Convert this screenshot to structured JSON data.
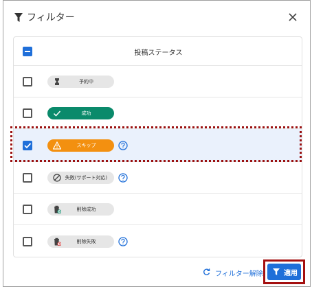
{
  "dialog": {
    "title": "フィルター",
    "title_icon": "filter-icon",
    "close_icon": "close-icon"
  },
  "table": {
    "header": "投稿ステータス",
    "select_all_state": "indeterminate",
    "rows": [
      {
        "label": "予約中",
        "icon": "hourglass-icon",
        "checked": false,
        "help": false
      },
      {
        "label": "成功",
        "icon": "check-icon",
        "checked": false,
        "help": false
      },
      {
        "label": "スキップ",
        "icon": "warning-icon",
        "checked": true,
        "help": true
      },
      {
        "label": "失敗(サポート対応)",
        "icon": "blocked-icon",
        "checked": false,
        "help": true
      },
      {
        "label": "削除成功",
        "icon": "trash-success-icon",
        "checked": false,
        "help": false
      },
      {
        "label": "削除失敗",
        "icon": "trash-error-icon",
        "checked": false,
        "help": true
      }
    ]
  },
  "footer": {
    "reset_label": "フィルター解除",
    "reset_icon": "refresh-icon",
    "apply_label": "適用",
    "apply_icon": "filter-icon"
  },
  "colors": {
    "accent": "#1f6fd9",
    "success": "#0a8a6b",
    "warning": "#f39010",
    "selected_row": "#eaf1fc",
    "annotation": "#a40f0f"
  }
}
